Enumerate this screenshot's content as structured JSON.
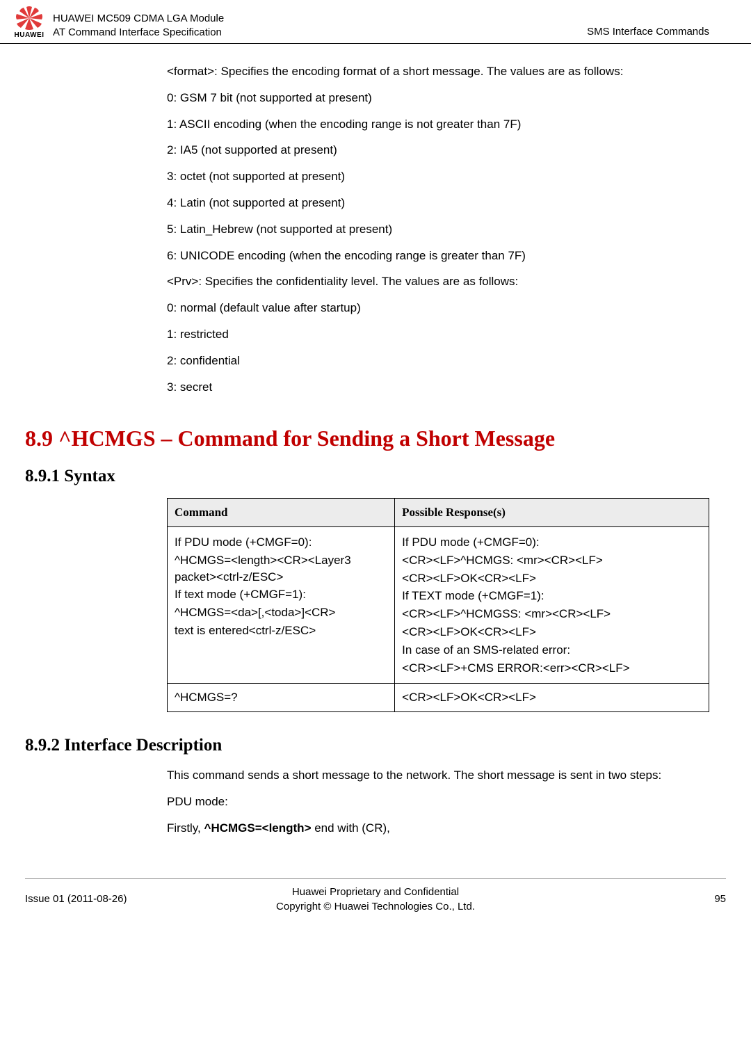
{
  "header": {
    "title_line1": "HUAWEI MC509 CDMA LGA Module",
    "title_line2": "AT Command Interface Specification",
    "right": "SMS Interface Commands",
    "logo_text": "HUAWEI"
  },
  "body": {
    "p_format_intro": "<format>: Specifies the encoding format of a short message. The values are as follows:",
    "p_format_0": "0: GSM 7 bit (not supported at present)",
    "p_format_1": "1: ASCII encoding (when the encoding range is not greater than 7F)",
    "p_format_2": "2: IA5 (not supported at present)",
    "p_format_3": "3: octet (not supported at present)",
    "p_format_4": "4: Latin (not supported at present)",
    "p_format_5": "5: Latin_Hebrew (not supported at present)",
    "p_format_6": "6: UNICODE encoding (when the encoding range is greater than 7F)",
    "p_prv_intro": "<Prv>: Specifies the confidentiality level. The values are as follows:",
    "p_prv_0": "0: normal (default value after startup)",
    "p_prv_1": "1: restricted",
    "p_prv_2": "2: confidential",
    "p_prv_3": "3: secret"
  },
  "section": {
    "h1": "8.9 ^HCMGS – Command for Sending a Short Message",
    "h2_syntax": "8.9.1 Syntax",
    "h2_desc": "8.9.2 Interface Description"
  },
  "table": {
    "th_cmd": "Command",
    "th_resp": "Possible Response(s)",
    "r1c1_l1": "If PDU mode (+CMGF=0):",
    "r1c1_l2": "^HCMGS=<length><CR><Layer3 packet><ctrl-z/ESC>",
    "r1c1_l3": "If text mode (+CMGF=1):",
    "r1c1_l4": "^HCMGS=<da>[,<toda>]<CR>",
    "r1c1_l5": "text is entered<ctrl-z/ESC>",
    "r1c2_l1": "If PDU mode (+CMGF=0):",
    "r1c2_l2": "<CR><LF>^HCMGS: <mr><CR><LF>",
    "r1c2_l3": "<CR><LF>OK<CR><LF>",
    "r1c2_l4": "If TEXT mode (+CMGF=1):",
    "r1c2_l5": "<CR><LF>^HCMGSS: <mr><CR><LF>",
    "r1c2_l6": "<CR><LF>OK<CR><LF>",
    "r1c2_l7": "In case of an SMS-related error:",
    "r1c2_l8": "<CR><LF>+CMS ERROR:<err><CR><LF>",
    "r2c1": "^HCMGS=?",
    "r2c2": "<CR><LF>OK<CR><LF>"
  },
  "desc": {
    "p1": "This command sends a short message to the network. The short message is sent in two steps:",
    "p2": "PDU mode:",
    "p3a": "Firstly, ",
    "p3b": "^HCMGS=<length>",
    "p3c": " end with (CR),"
  },
  "footer": {
    "left": "Issue 01 (2011-08-26)",
    "center_l1": "Huawei Proprietary and Confidential",
    "center_l2": "Copyright © Huawei Technologies Co., Ltd.",
    "right": "95"
  }
}
